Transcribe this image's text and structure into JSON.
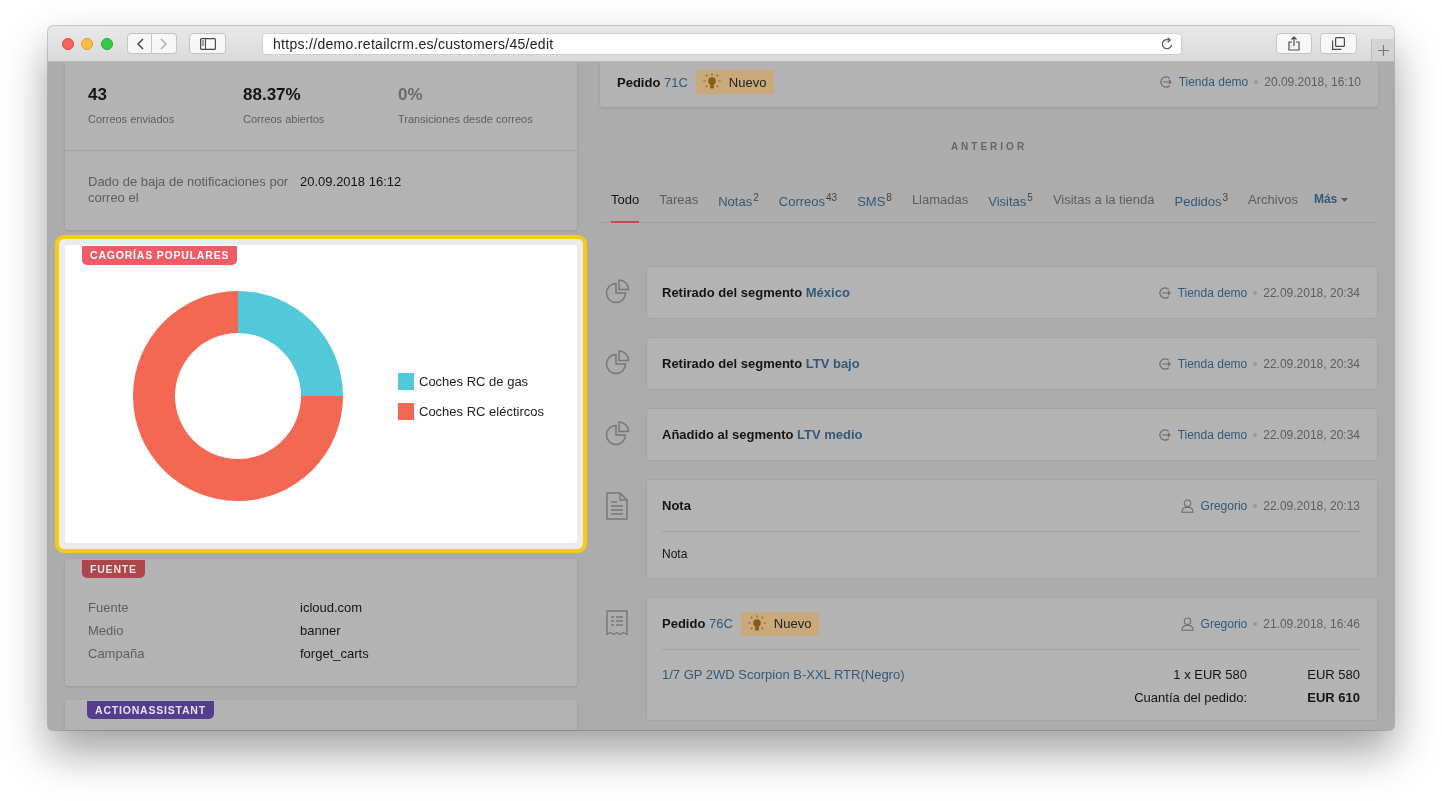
{
  "window": {
    "url": "https://demo.retailcrm.es/customers/45/edit",
    "forward_disabled": true
  },
  "email_stats": [
    {
      "value": "43",
      "label": "Correos enviados",
      "muted": false
    },
    {
      "value": "88.37%",
      "label": "Correos abiertos",
      "muted": false
    },
    {
      "value": "0%",
      "label": "Transiciones desde correos",
      "muted": true
    }
  ],
  "unsubscribed": {
    "label": "Dado de baja de notificaciones por correo el",
    "value": "20.09.2018 16:12"
  },
  "popular_categories": {
    "tag": "CAGORÍAS POPULARES",
    "highlighted": true,
    "legend": [
      {
        "label": "Coches RC de gas",
        "color": "#52c8d8"
      },
      {
        "label": "Coches RC eléctircos",
        "color": "#f26852"
      }
    ]
  },
  "source": {
    "tag": "FUENTE",
    "rows": [
      {
        "label": "Fuente",
        "value": "icloud.com"
      },
      {
        "label": "Medio",
        "value": "banner"
      },
      {
        "label": "Campaña",
        "value": "forget_carts"
      }
    ]
  },
  "action_assistant": {
    "tag": "ACTIONASSISTANT"
  },
  "upcoming_order": {
    "title": "Pedido",
    "link": "71C",
    "status": "Nuevo",
    "actor": {
      "kind": "store",
      "name": "Tienda demo"
    },
    "date": "20.09.2018, 16:10"
  },
  "history": {
    "heading": "ANTERIOR",
    "tabs": [
      {
        "label": "Todo",
        "kind": "tab",
        "selected": true,
        "disabled": false
      },
      {
        "label": "Tareas",
        "kind": "tab",
        "selected": false,
        "disabled": true
      },
      {
        "label": "Notas$^{2}$",
        "kind": "tab",
        "selected": false,
        "disabled": false
      },
      {
        "label": "Correos$^{43}$",
        "kind": "tab",
        "selected": false,
        "disabled": false
      },
      {
        "label": "SMS$^{8}$",
        "kind": "tab",
        "selected": false,
        "disabled": false
      },
      {
        "label": "Llamadas",
        "kind": "tab",
        "selected": false,
        "disabled": true
      },
      {
        "label": "Visitas$^{5}$",
        "kind": "tab",
        "selected": false,
        "disabled": false
      },
      {
        "label": "Visitas a la tienda",
        "kind": "tab",
        "selected": false,
        "disabled": true
      },
      {
        "label": "Pedidos$^{3}$",
        "kind": "tab",
        "selected": false,
        "disabled": false
      },
      {
        "label": "Archivos",
        "kind": "tab",
        "selected": false,
        "disabled": true
      },
      {
        "label": "Más",
        "kind": "dropdown",
        "selected": false,
        "disabled": false
      }
    ],
    "events": [
      {
        "kind": "segment",
        "title": "Retirado del segmento",
        "link": "México",
        "actor": {
          "kind": "store",
          "name": "Tienda demo"
        },
        "date": "22.09.2018, 20:34"
      },
      {
        "kind": "segment",
        "title": "Retirado del segmento",
        "link": "LTV bajo",
        "actor": {
          "kind": "store",
          "name": "Tienda demo"
        },
        "date": "22.09.2018, 20:34"
      },
      {
        "kind": "segment",
        "title": "Añadido al segmento",
        "link": "LTV medio",
        "actor": {
          "kind": "store",
          "name": "Tienda demo"
        },
        "date": "22.09.2018, 20:34"
      },
      {
        "kind": "note",
        "title": "Nota",
        "actor": {
          "kind": "user",
          "name": "Gregorio"
        },
        "date": "22.09.2018, 20:13",
        "body": "Nota"
      },
      {
        "kind": "order",
        "title": "Pedido",
        "link": "76C",
        "status": "Nuevo",
        "actor": {
          "kind": "user",
          "name": "Gregorio"
        },
        "date": "21.09.2018, 16:46",
        "items": [
          {
            "name": "1/7 GP 2WD Scorpion B-XXL RTR(Negro)",
            "quantity": "1 x EUR 580",
            "amount": "EUR 580"
          }
        ],
        "total_label": "Cuantía del pedido:",
        "total": "EUR 610"
      }
    ]
  }
}
